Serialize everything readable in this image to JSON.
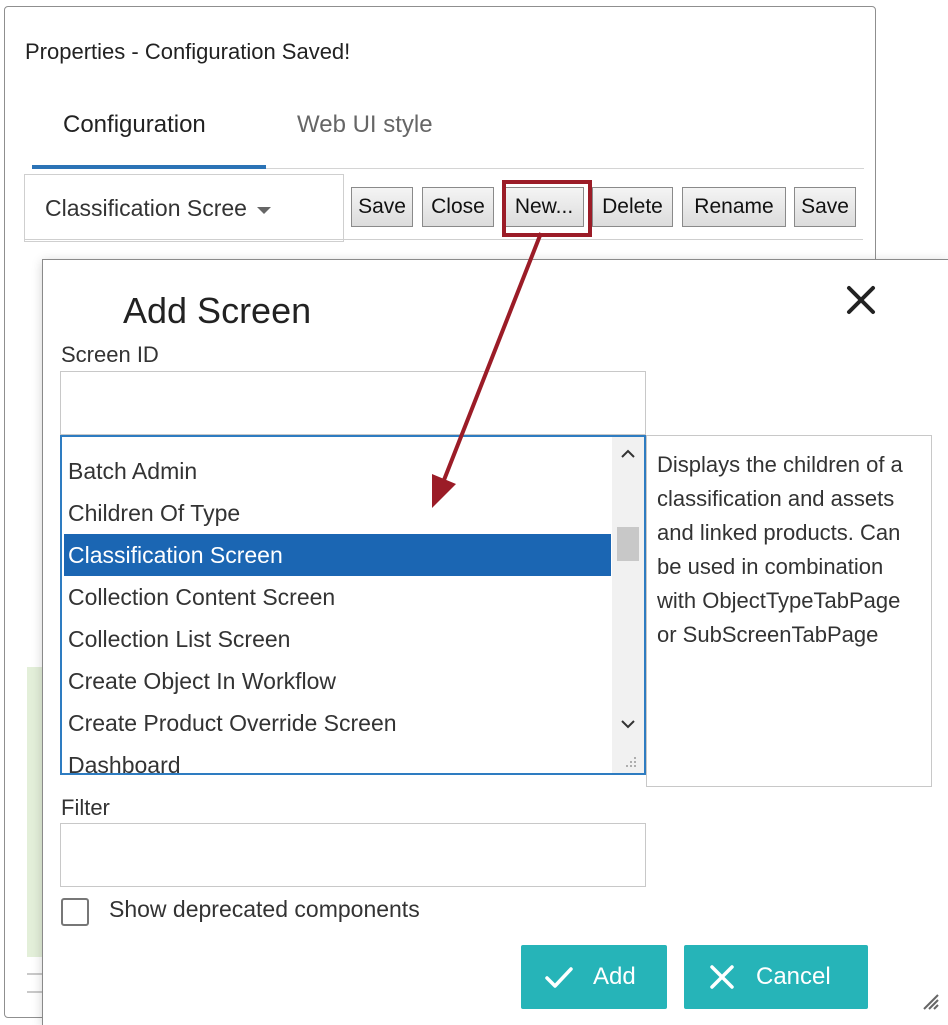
{
  "properties_panel": {
    "title": "Properties - Configuration Saved!",
    "tabs": [
      {
        "label": "Configuration",
        "active": true
      },
      {
        "label": "Web UI style",
        "active": false
      }
    ],
    "screen_select_value": "Classification Scree",
    "toolbar_buttons": [
      "Save",
      "Close",
      "New...",
      "Delete",
      "Rename",
      "Save"
    ]
  },
  "dialog": {
    "title": "Add Screen",
    "screen_id_label": "Screen ID",
    "screen_id_value": "",
    "list_items": [
      "Batch Admin",
      "Children Of Type",
      "Classification Screen",
      "Collection Content Screen",
      "Collection List Screen",
      "Create Object In Workflow",
      "Create Product Override Screen",
      "Dashboard"
    ],
    "selected_item": "Classification Screen",
    "description": "Displays the children of a classification and assets and linked products. Can be used in combination with ObjectTypeTabPage or SubScreenTabPage",
    "filter_label": "Filter",
    "filter_value": "",
    "show_deprecated_label": "Show deprecated components",
    "show_deprecated_checked": false,
    "add_label": "Add",
    "cancel_label": "Cancel"
  },
  "colors": {
    "tab_accent": "#2b73b6",
    "selection": "#1b66b3",
    "primary_button": "#26b4b8",
    "annotation": "#9b1c27"
  },
  "icons": [
    "close-icon",
    "check-icon",
    "cancel-x-icon",
    "chevron-up-icon",
    "chevron-down-icon",
    "resize-grip-icon",
    "dropdown-caret-icon"
  ]
}
